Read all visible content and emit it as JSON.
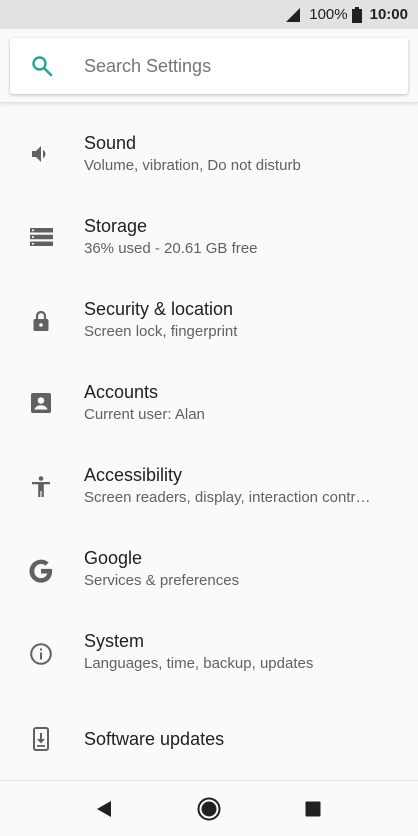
{
  "status_bar": {
    "battery_percent": "100%",
    "time": "10:00",
    "icons": [
      "signal-icon",
      "battery-icon"
    ]
  },
  "search": {
    "placeholder": "Search Settings",
    "accent_color": "#26a69a"
  },
  "settings": [
    {
      "title": "Sound",
      "summary": "Volume, vibration, Do not disturb",
      "icon": "volume-icon"
    },
    {
      "title": "Storage",
      "summary": "36% used - 20.61 GB free",
      "icon": "storage-icon"
    },
    {
      "title": "Security & location",
      "summary": "Screen lock, fingerprint",
      "icon": "lock-icon"
    },
    {
      "title": "Accounts",
      "summary": "Current user: Alan",
      "icon": "account-icon"
    },
    {
      "title": "Accessibility",
      "summary": "Screen readers, display, interaction contr…",
      "icon": "accessibility-icon"
    },
    {
      "title": "Google",
      "summary": "Services & preferences",
      "icon": "google-icon"
    },
    {
      "title": "System",
      "summary": "Languages, time, backup, updates",
      "icon": "info-icon"
    },
    {
      "title": "Software updates",
      "summary": "",
      "icon": "system-update-icon"
    }
  ],
  "nav_bar": {
    "icons": [
      "back-icon",
      "home-icon",
      "recents-icon"
    ]
  }
}
